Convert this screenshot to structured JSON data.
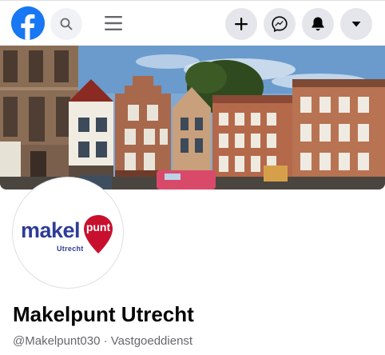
{
  "topbar": {
    "icons": {
      "logo": "facebook-logo",
      "search": "search-icon",
      "menu": "hamburger-menu-icon",
      "create": "plus-icon",
      "messenger": "messenger-icon",
      "notifications": "bell-icon",
      "account": "caret-down-icon"
    }
  },
  "cover": {
    "description_icon": "cover-photo"
  },
  "profile": {
    "logo": {
      "word": "makel",
      "pin_text": "punt",
      "sub": "Utrecht"
    },
    "name": "Makelpunt Utrecht",
    "meta": "@Makelpunt030 · Vastgoeddienst"
  },
  "colors": {
    "brand_blue": "#1877f2",
    "logo_navy": "#2e3c98",
    "logo_red": "#c8102e",
    "secondary_text": "#65676b",
    "button_bg": "#e4e6eb"
  }
}
